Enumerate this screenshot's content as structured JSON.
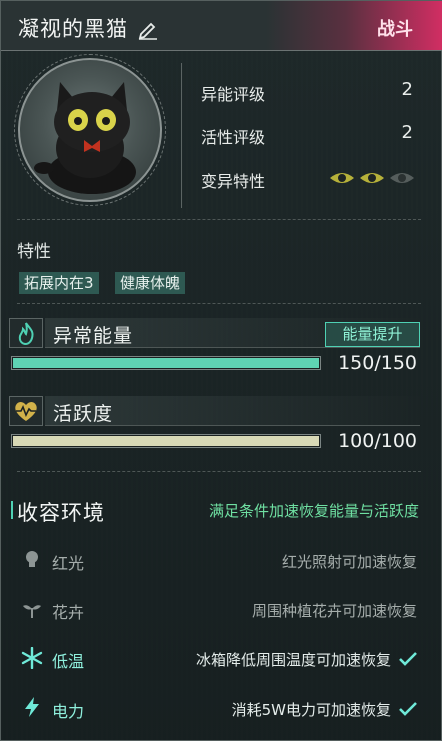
{
  "header": {
    "character_name": "凝视的黑猫",
    "battle_label": "战斗"
  },
  "stats": [
    {
      "label": "异能评级",
      "value": "2"
    },
    {
      "label": "活性评级",
      "value": "2"
    },
    {
      "label": "变异特性"
    }
  ],
  "mutation_eyes": {
    "active": 2,
    "total": 3
  },
  "traits": {
    "title": "特性",
    "items": [
      "拓展内在3",
      "健康体魄"
    ]
  },
  "energy": {
    "title": "异常能量",
    "upgrade_label": "能量提升",
    "current": 150,
    "max": 150,
    "display": "150/150",
    "color": "#5fd3b3"
  },
  "activity": {
    "title": "活跃度",
    "current": 100,
    "max": 100,
    "display": "100/100",
    "color": "#d8d9b6"
  },
  "environment": {
    "title": "收容环境",
    "hint": "满足条件加速恢复能量与活跃度",
    "items": [
      {
        "name": "红光",
        "desc": "红光照射可加速恢复",
        "icon": "bulb-icon",
        "active": false
      },
      {
        "name": "花卉",
        "desc": "周围种植花卉可加速恢复",
        "icon": "sprout-icon",
        "active": false
      },
      {
        "name": "低温",
        "desc": "冰箱降低周围温度可加速恢复",
        "icon": "snowflake-icon",
        "active": true
      },
      {
        "name": "电力",
        "desc": "消耗5W电力可加速恢复",
        "icon": "lightning-icon",
        "active": true
      }
    ]
  },
  "colors": {
    "accent": "#4fd1b4",
    "battle_tag": "#d22e63",
    "hint_green": "#6fe0a2"
  }
}
